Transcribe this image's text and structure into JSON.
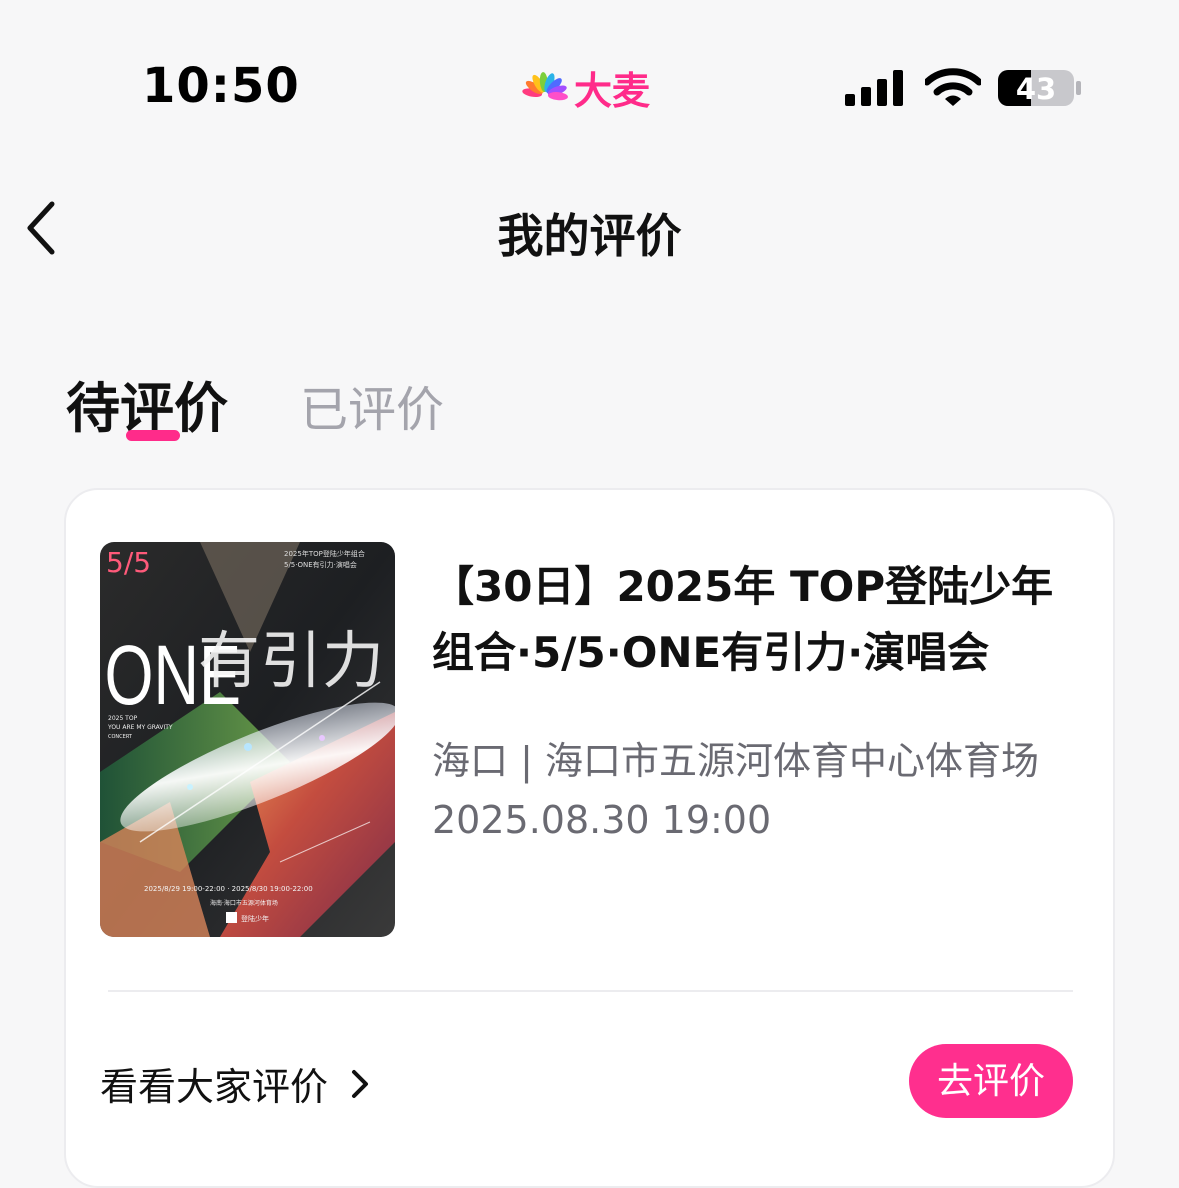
{
  "status_bar": {
    "time": "10:50",
    "app_name": "大麦",
    "battery_level": "43",
    "icons": [
      "damai-logo-icon",
      "signal-icon",
      "wifi-icon",
      "battery-icon"
    ]
  },
  "nav": {
    "back_icon": "chevron-left-icon",
    "title": "我的评价"
  },
  "tabs": [
    {
      "label": "待评价",
      "active": true
    },
    {
      "label": "已评价",
      "active": false
    }
  ],
  "colors": {
    "accent": "#ff2b8a",
    "background": "#f7f7f8",
    "card": "#ffffff",
    "muted_text": "#6a6a72",
    "inactive_tab": "#a4a4ac"
  },
  "card": {
    "poster": {
      "badge": "5/5",
      "brand": "ONE",
      "title_art": "有引力",
      "header_line1": "2025年TOP登陆少年组合",
      "header_line2": "5/5·ONE有引力·演唱会",
      "subtitle_line1": "2025 TOP",
      "subtitle_line2": "YOU ARE MY GRAVITY",
      "subtitle_line3": "CONCERT",
      "dates": "2025/8/29 19:00-22:00 · 2025/8/30 19:00-22:00",
      "venue": "海南·海口市五源河体育场",
      "logo_text": "登陆少年"
    },
    "title": "【30日】2025年 TOP登陆少年组合·5/5·ONE有引力·演唱会",
    "venue": "海口 | 海口市五源河体育中心体育场",
    "datetime": "2025.08.30 19:00",
    "see_all_label": "看看大家评价",
    "see_all_icon": "chevron-right-icon",
    "review_button": "去评价"
  }
}
